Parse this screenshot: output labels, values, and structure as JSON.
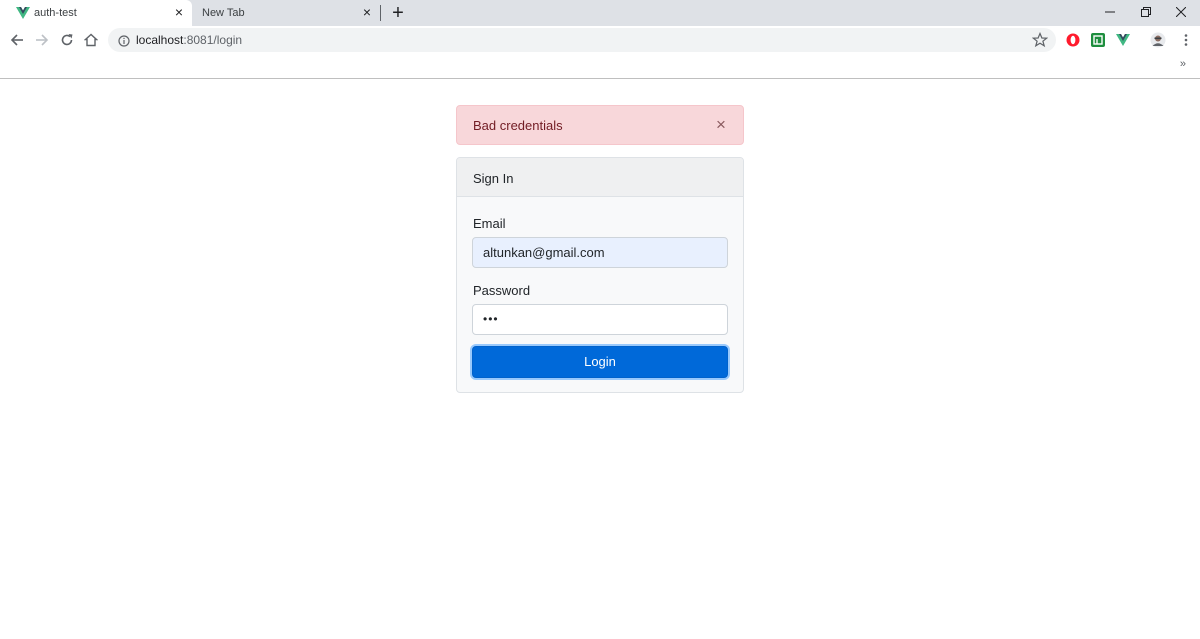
{
  "browser": {
    "tabs": [
      {
        "title": "auth-test",
        "active": true,
        "favicon": "vue-logo-icon"
      },
      {
        "title": "New Tab",
        "active": false
      }
    ],
    "new_tab_symbol": "+",
    "tab_close_symbol": "×",
    "url": {
      "host": "localhost",
      "path": ":8081/login"
    },
    "bookmarks_overflow": "»"
  },
  "colors": {
    "alert_bg": "#f8d7da",
    "alert_text": "#721c24",
    "button_primary": "#0069d9",
    "autofill_bg": "#e8f0fe"
  },
  "alert": {
    "message": "Bad credentials",
    "close_symbol": "×"
  },
  "form": {
    "header": "Sign In",
    "email_label": "Email",
    "email_value": "altunkan@gmail.com",
    "password_label": "Password",
    "password_value": "•••",
    "submit_label": "Login"
  }
}
